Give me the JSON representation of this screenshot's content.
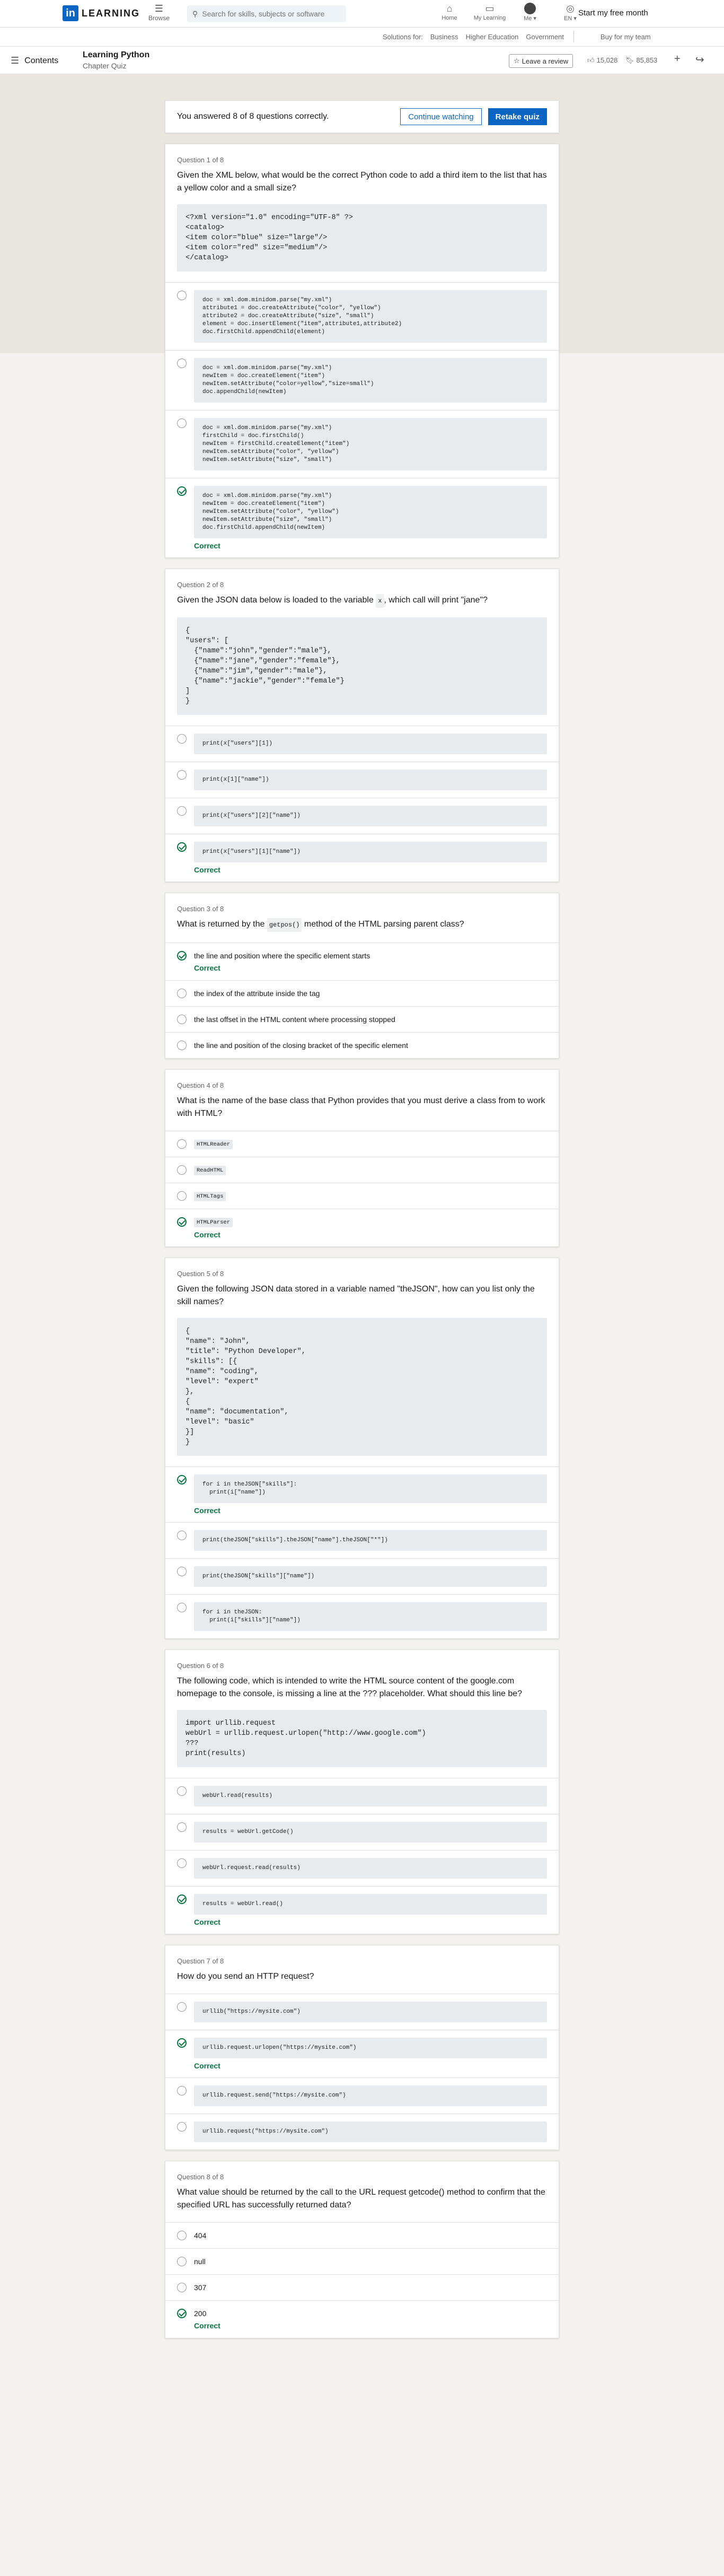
{
  "nav": {
    "logo_letters": "in",
    "logo_text": "LEARNING",
    "browse_label": "Browse",
    "search_placeholder": "Search for skills, subjects or software",
    "items": [
      {
        "label": "Home"
      },
      {
        "label": "My Learning"
      },
      {
        "label": "Me ▾"
      },
      {
        "label": "EN ▾"
      }
    ],
    "trial": "Start my free month"
  },
  "subnav": {
    "solutions_label": "Solutions for:",
    "links": [
      "Business",
      "Higher Education",
      "Government"
    ],
    "team": "Buy for my team"
  },
  "course": {
    "contents_label": "Contents",
    "title": "Learning Python",
    "chapter": "Chapter Quiz",
    "review_label": "Leave a review",
    "likes": "15,028",
    "saves": "85,853"
  },
  "result": {
    "message": "You answered 8 of 8 questions correctly.",
    "continue_label": "Continue watching",
    "retake_label": "Retake quiz"
  },
  "correct_label": "Correct",
  "questions": [
    {
      "number": "Question 1 of 8",
      "text": "Given the XML below, what would be the correct Python code to add a third item to the list that has a yellow color and a small size?",
      "code": "<?xml version=\"1.0\" encoding=\"UTF-8\" ?>\n<catalog>\n<item color=\"blue\" size=\"large\"/>\n<item color=\"red\" size=\"medium\"/>\n</catalog>",
      "options": [
        "doc = xml.dom.minidom.parse(\"my.xml\")\nattribute1 = doc.createAttribute(\"color\", \"yellow\")\nattribute2 = doc.createAttribute(\"size\", \"small\")\nelement = doc.insertElement(\"item\",attribute1,attribute2)\ndoc.firstChild.appendChild(element)",
        "doc = xml.dom.minidom.parse(\"my.xml\")\nnewItem = doc.createElement(\"item\")\nnewItem.setAttribute(\"color=yellow\",\"size=small\")\ndoc.appendChild(newItem)",
        "doc = xml.dom.minidom.parse(\"my.xml\")\nfirstChild = doc.firstChild()\nnewItem = firstChild.createElement(\"item\")\nnewItem.setAttribute(\"color\", \"yellow\")\nnewItem.setAttribute(\"size\", \"small\")",
        "doc = xml.dom.minidom.parse(\"my.xml\")\nnewItem = doc.createElement(\"item\")\nnewItem.setAttribute(\"color\", \"yellow\")\nnewItem.setAttribute(\"size\", \"small\")\ndoc.firstChild.appendChild(newItem)"
      ]
    },
    {
      "number": "Question 2 of 8",
      "text_before": "Given the JSON data below is loaded to the variable ",
      "inline_code": "x",
      "text_after": ", which call will print \"jane\"?",
      "code": "{\n\"users\": [\n  {\"name\":\"john\",\"gender\":\"male\"},\n  {\"name\":\"jane\",\"gender\":\"female\"},\n  {\"name\":\"jim\",\"gender\":\"male\"},\n  {\"name\":\"jackie\",\"gender\":\"female\"}\n]\n}",
      "options": [
        "print(x[\"users\"][1])",
        "print(x[1][\"name\"])",
        "print(x[\"users\"][2][\"name\"])",
        "print(x[\"users\"][1][\"name\"])"
      ]
    },
    {
      "number": "Question 3 of 8",
      "text_before": "What is returned by the ",
      "inline_code": "getpos()",
      "text_after": " method of the HTML parsing parent class?",
      "options": [
        "the line and position where the specific element starts",
        "the index of the attribute inside the tag",
        "the last offset in the HTML content where processing stopped",
        "the line and position of the closing bracket of the specific element"
      ]
    },
    {
      "number": "Question 4 of 8",
      "text": "What is the name of the base class that Python provides that you must derive a class from to work with HTML?",
      "options": [
        "HTMLReader",
        "ReadHTML",
        "HTMLTags",
        "HTMLParser"
      ]
    },
    {
      "number": "Question 5 of 8",
      "text": "Given the following JSON data stored in a variable named \"theJSON\", how can you list only the skill names?",
      "code": "{\n\"name\": \"John\",\n\"title\": \"Python Developer\",\n\"skills\": [{\n\"name\": \"coding\",\n\"level\": \"expert\"\n},\n{\n\"name\": \"documentation\",\n\"level\": \"basic\"\n}]\n}",
      "options": [
        "for i in theJSON[\"skills\"]:\n  print(i[\"name\"])",
        "print(theJSON[\"skills\"].theJSON[\"name\"].theJSON[\"*\"])",
        "print(theJSON[\"skills\"][\"name\"])",
        "for i in theJSON:\n  print(i[\"skills\"][\"name\"])"
      ]
    },
    {
      "number": "Question 6 of 8",
      "text": "The following code, which is intended to write the HTML source content of the google.com homepage to the console, is missing a line at the ??? placeholder. What should this line be?",
      "code": "import urllib.request\nwebUrl = urllib.request.urlopen(\"http://www.google.com\")\n???\nprint(results)",
      "options": [
        "webUrl.read(results)",
        "results = webUrl.getCode()",
        "webUrl.request.read(results)",
        "results = webUrl.read()"
      ]
    },
    {
      "number": "Question 7 of 8",
      "text": "How do you send an HTTP request?",
      "options": [
        "urllib(\"https://mysite.com\")",
        "urllib.request.urlopen(\"https://mysite.com\")",
        "urllib.request.send(\"https://mysite.com\")",
        "urllib.request(\"https://mysite.com\")"
      ]
    },
    {
      "number": "Question 8 of 8",
      "text": "What value should be returned by the call to the URL request getcode() method to confirm that the specified URL has successfully returned data?",
      "options": [
        "404",
        "null",
        "307",
        "200"
      ]
    }
  ],
  "correct_answers": [
    3,
    3,
    0,
    3,
    0,
    3,
    1,
    3
  ]
}
